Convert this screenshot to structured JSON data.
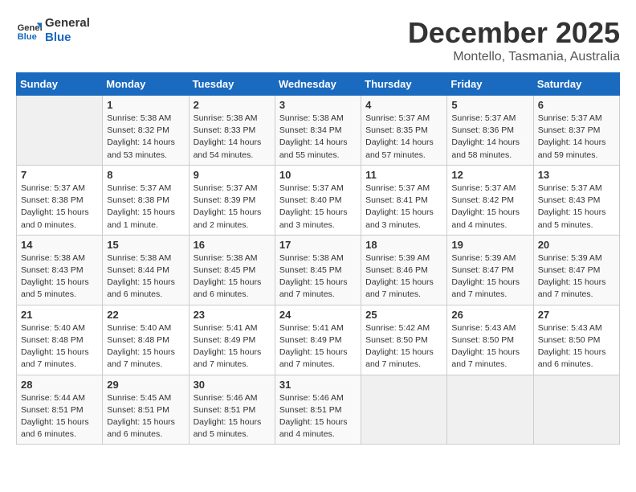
{
  "logo": {
    "line1": "General",
    "line2": "Blue"
  },
  "title": "December 2025",
  "subtitle": "Montello, Tasmania, Australia",
  "days_header": [
    "Sunday",
    "Monday",
    "Tuesday",
    "Wednesday",
    "Thursday",
    "Friday",
    "Saturday"
  ],
  "weeks": [
    [
      {
        "day": "",
        "info": ""
      },
      {
        "day": "1",
        "info": "Sunrise: 5:38 AM\nSunset: 8:32 PM\nDaylight: 14 hours\nand 53 minutes."
      },
      {
        "day": "2",
        "info": "Sunrise: 5:38 AM\nSunset: 8:33 PM\nDaylight: 14 hours\nand 54 minutes."
      },
      {
        "day": "3",
        "info": "Sunrise: 5:38 AM\nSunset: 8:34 PM\nDaylight: 14 hours\nand 55 minutes."
      },
      {
        "day": "4",
        "info": "Sunrise: 5:37 AM\nSunset: 8:35 PM\nDaylight: 14 hours\nand 57 minutes."
      },
      {
        "day": "5",
        "info": "Sunrise: 5:37 AM\nSunset: 8:36 PM\nDaylight: 14 hours\nand 58 minutes."
      },
      {
        "day": "6",
        "info": "Sunrise: 5:37 AM\nSunset: 8:37 PM\nDaylight: 14 hours\nand 59 minutes."
      }
    ],
    [
      {
        "day": "7",
        "info": "Sunrise: 5:37 AM\nSunset: 8:38 PM\nDaylight: 15 hours\nand 0 minutes."
      },
      {
        "day": "8",
        "info": "Sunrise: 5:37 AM\nSunset: 8:38 PM\nDaylight: 15 hours\nand 1 minute."
      },
      {
        "day": "9",
        "info": "Sunrise: 5:37 AM\nSunset: 8:39 PM\nDaylight: 15 hours\nand 2 minutes."
      },
      {
        "day": "10",
        "info": "Sunrise: 5:37 AM\nSunset: 8:40 PM\nDaylight: 15 hours\nand 3 minutes."
      },
      {
        "day": "11",
        "info": "Sunrise: 5:37 AM\nSunset: 8:41 PM\nDaylight: 15 hours\nand 3 minutes."
      },
      {
        "day": "12",
        "info": "Sunrise: 5:37 AM\nSunset: 8:42 PM\nDaylight: 15 hours\nand 4 minutes."
      },
      {
        "day": "13",
        "info": "Sunrise: 5:37 AM\nSunset: 8:43 PM\nDaylight: 15 hours\nand 5 minutes."
      }
    ],
    [
      {
        "day": "14",
        "info": "Sunrise: 5:38 AM\nSunset: 8:43 PM\nDaylight: 15 hours\nand 5 minutes."
      },
      {
        "day": "15",
        "info": "Sunrise: 5:38 AM\nSunset: 8:44 PM\nDaylight: 15 hours\nand 6 minutes."
      },
      {
        "day": "16",
        "info": "Sunrise: 5:38 AM\nSunset: 8:45 PM\nDaylight: 15 hours\nand 6 minutes."
      },
      {
        "day": "17",
        "info": "Sunrise: 5:38 AM\nSunset: 8:45 PM\nDaylight: 15 hours\nand 7 minutes."
      },
      {
        "day": "18",
        "info": "Sunrise: 5:39 AM\nSunset: 8:46 PM\nDaylight: 15 hours\nand 7 minutes."
      },
      {
        "day": "19",
        "info": "Sunrise: 5:39 AM\nSunset: 8:47 PM\nDaylight: 15 hours\nand 7 minutes."
      },
      {
        "day": "20",
        "info": "Sunrise: 5:39 AM\nSunset: 8:47 PM\nDaylight: 15 hours\nand 7 minutes."
      }
    ],
    [
      {
        "day": "21",
        "info": "Sunrise: 5:40 AM\nSunset: 8:48 PM\nDaylight: 15 hours\nand 7 minutes."
      },
      {
        "day": "22",
        "info": "Sunrise: 5:40 AM\nSunset: 8:48 PM\nDaylight: 15 hours\nand 7 minutes."
      },
      {
        "day": "23",
        "info": "Sunrise: 5:41 AM\nSunset: 8:49 PM\nDaylight: 15 hours\nand 7 minutes."
      },
      {
        "day": "24",
        "info": "Sunrise: 5:41 AM\nSunset: 8:49 PM\nDaylight: 15 hours\nand 7 minutes."
      },
      {
        "day": "25",
        "info": "Sunrise: 5:42 AM\nSunset: 8:50 PM\nDaylight: 15 hours\nand 7 minutes."
      },
      {
        "day": "26",
        "info": "Sunrise: 5:43 AM\nSunset: 8:50 PM\nDaylight: 15 hours\nand 7 minutes."
      },
      {
        "day": "27",
        "info": "Sunrise: 5:43 AM\nSunset: 8:50 PM\nDaylight: 15 hours\nand 6 minutes."
      }
    ],
    [
      {
        "day": "28",
        "info": "Sunrise: 5:44 AM\nSunset: 8:51 PM\nDaylight: 15 hours\nand 6 minutes."
      },
      {
        "day": "29",
        "info": "Sunrise: 5:45 AM\nSunset: 8:51 PM\nDaylight: 15 hours\nand 6 minutes."
      },
      {
        "day": "30",
        "info": "Sunrise: 5:46 AM\nSunset: 8:51 PM\nDaylight: 15 hours\nand 5 minutes."
      },
      {
        "day": "31",
        "info": "Sunrise: 5:46 AM\nSunset: 8:51 PM\nDaylight: 15 hours\nand 4 minutes."
      },
      {
        "day": "",
        "info": ""
      },
      {
        "day": "",
        "info": ""
      },
      {
        "day": "",
        "info": ""
      }
    ]
  ]
}
